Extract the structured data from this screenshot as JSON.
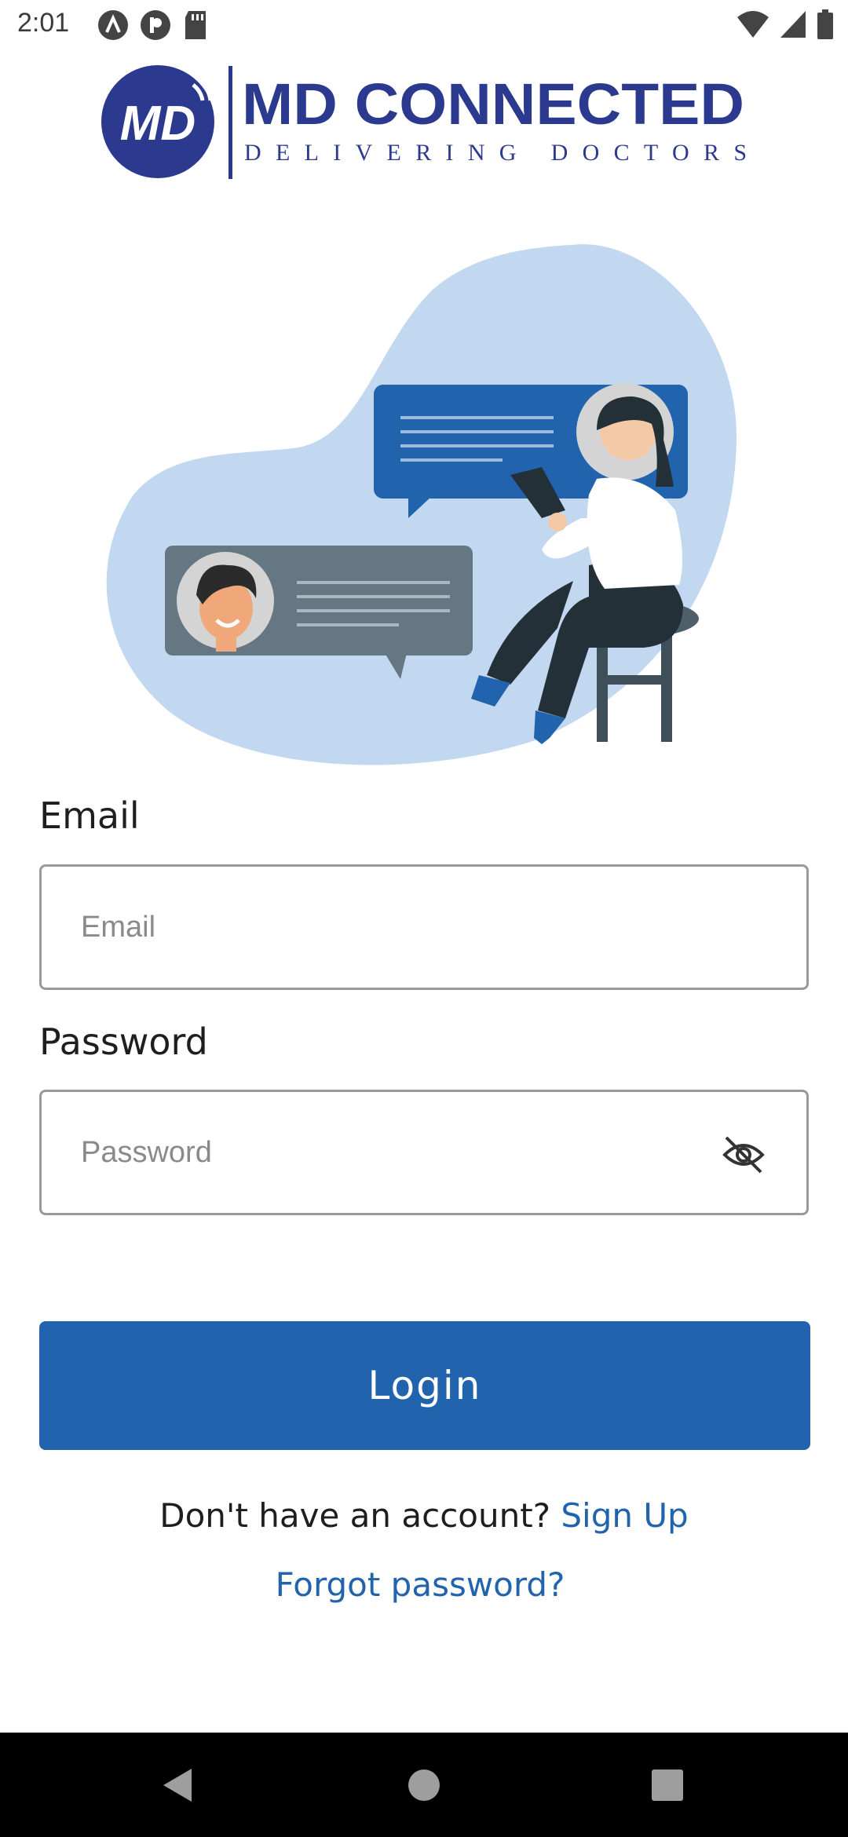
{
  "status_bar": {
    "time": "2:01",
    "left_icons": [
      "app-a-icon",
      "app-p-icon",
      "sd-card-icon"
    ],
    "right_icons": [
      "wifi-icon",
      "signal-icon",
      "battery-icon"
    ]
  },
  "brand": {
    "logo_mark": "MD",
    "name": "MD CONNECTED",
    "tagline": "DELIVERING DOCTORS",
    "color": "#2b3a8f"
  },
  "form": {
    "email_label": "Email",
    "email_placeholder": "Email",
    "email_value": "",
    "password_label": "Password",
    "password_placeholder": "Password",
    "password_value": "",
    "password_toggle_icon": "eye-off-icon"
  },
  "actions": {
    "login_label": "Login",
    "signup_prompt": "Don't have an account?",
    "signup_link": "Sign Up",
    "forgot_password": "Forgot password?"
  },
  "colors": {
    "accent": "#2263ad",
    "blob": "#c2d8f1",
    "bubble_blue": "#2263ad",
    "bubble_gray": "#657783"
  },
  "nav": {
    "icons": [
      "back-icon",
      "home-icon",
      "recents-icon"
    ]
  }
}
